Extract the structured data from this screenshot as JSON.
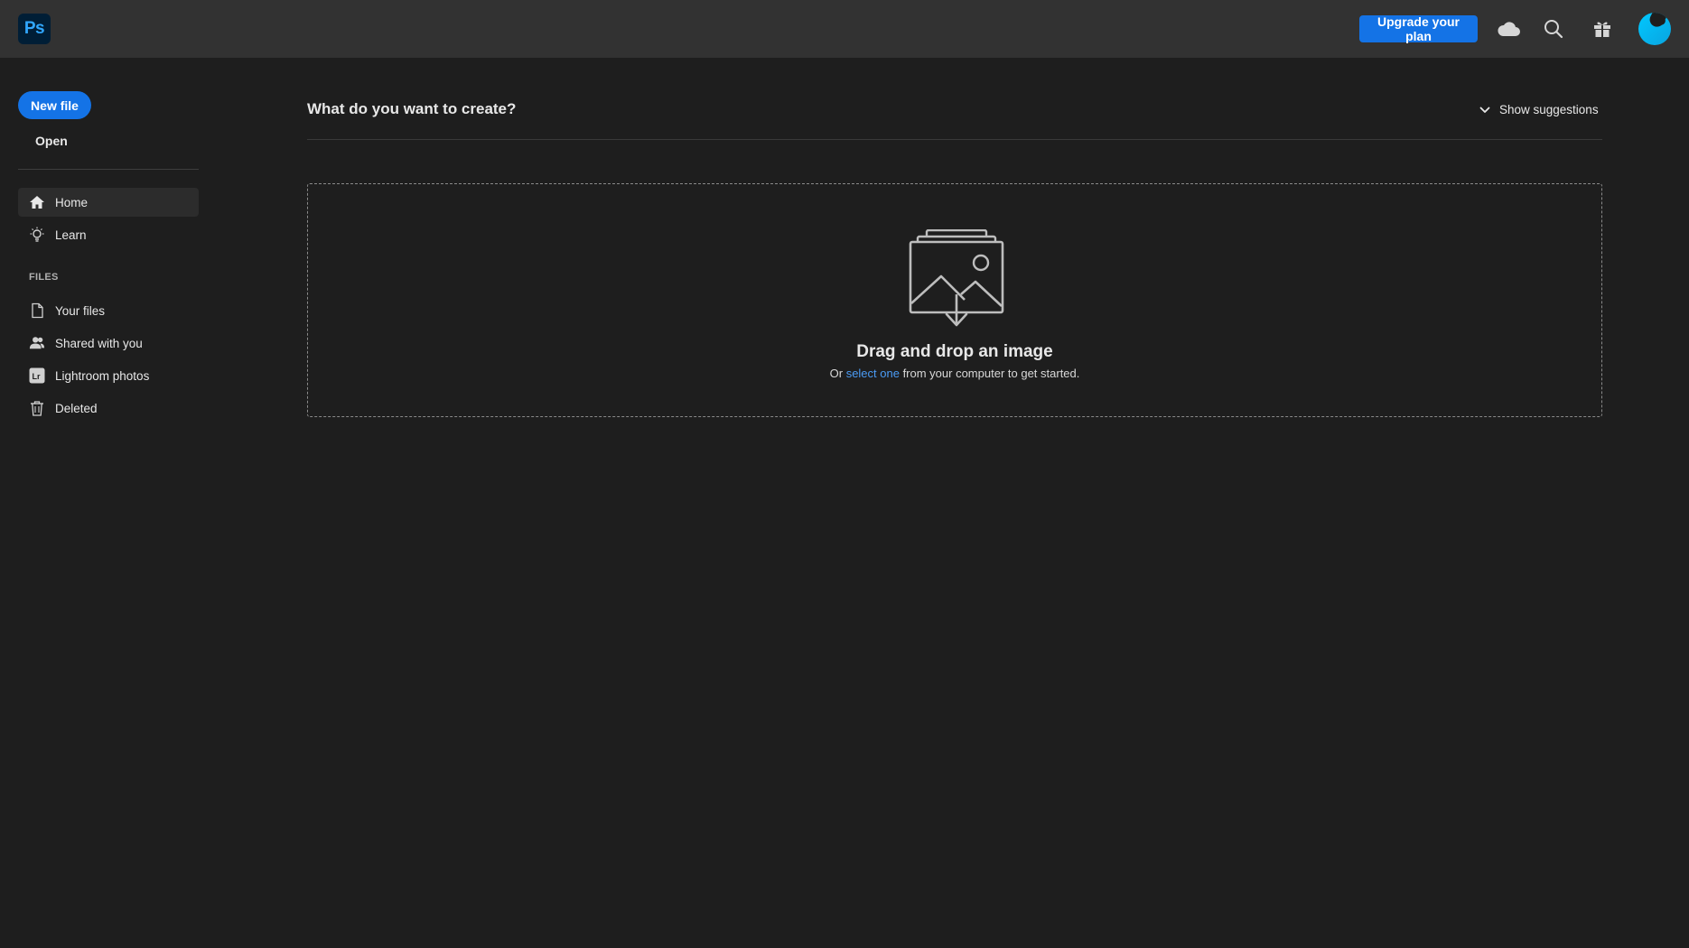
{
  "header": {
    "app_logo_text": "Ps",
    "upgrade_label": "Upgrade your plan",
    "icons": [
      "cloud-icon",
      "search-icon",
      "gift-icon"
    ]
  },
  "sidebar": {
    "new_file_label": "New file",
    "open_label": "Open",
    "nav": [
      {
        "label": "Home",
        "icon": "home-icon",
        "active": true
      },
      {
        "label": "Learn",
        "icon": "lightbulb-icon",
        "active": false
      }
    ],
    "files_heading": "FILES",
    "files": [
      {
        "label": "Your files",
        "icon": "document-icon"
      },
      {
        "label": "Shared with you",
        "icon": "people-icon"
      },
      {
        "label": "Lightroom photos",
        "icon": "lightroom-icon"
      },
      {
        "label": "Deleted",
        "icon": "trash-icon"
      }
    ]
  },
  "main": {
    "title": "What do you want to create?",
    "show_suggestions_label": "Show suggestions",
    "dropzone": {
      "title": "Drag and drop an image",
      "sub_prefix": "Or ",
      "sub_link": "select one",
      "sub_suffix": " from your computer to get started."
    }
  },
  "colors": {
    "accent": "#1473e6",
    "link": "#4b9cf5",
    "background": "#1e1e1e",
    "header": "#323232"
  }
}
